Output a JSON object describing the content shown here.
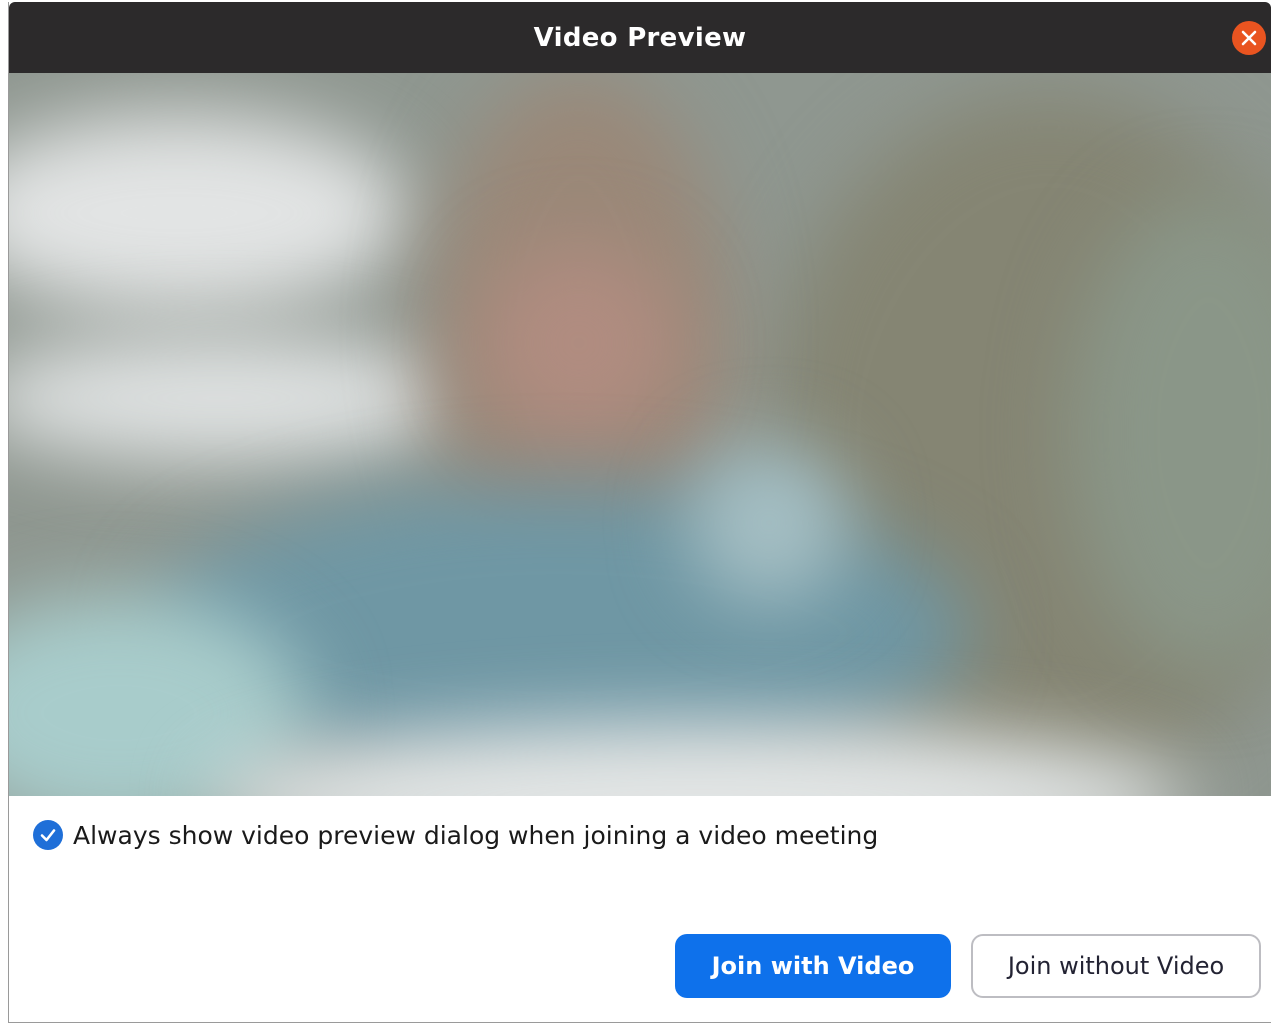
{
  "window": {
    "title": "Video Preview"
  },
  "preview": {
    "always_show_label": "Always show video preview dialog when joining a video meeting",
    "always_show_checked": true
  },
  "actions": {
    "join_with_video": "Join with Video",
    "join_without_video": "Join without Video"
  },
  "icons": {
    "close": "close-icon",
    "check": "checkmark-icon"
  },
  "colors": {
    "titlebar": "#2c2a2b",
    "close_button": "#e95420",
    "primary_button": "#0e71eb",
    "checkbox": "#1f6fd8"
  }
}
